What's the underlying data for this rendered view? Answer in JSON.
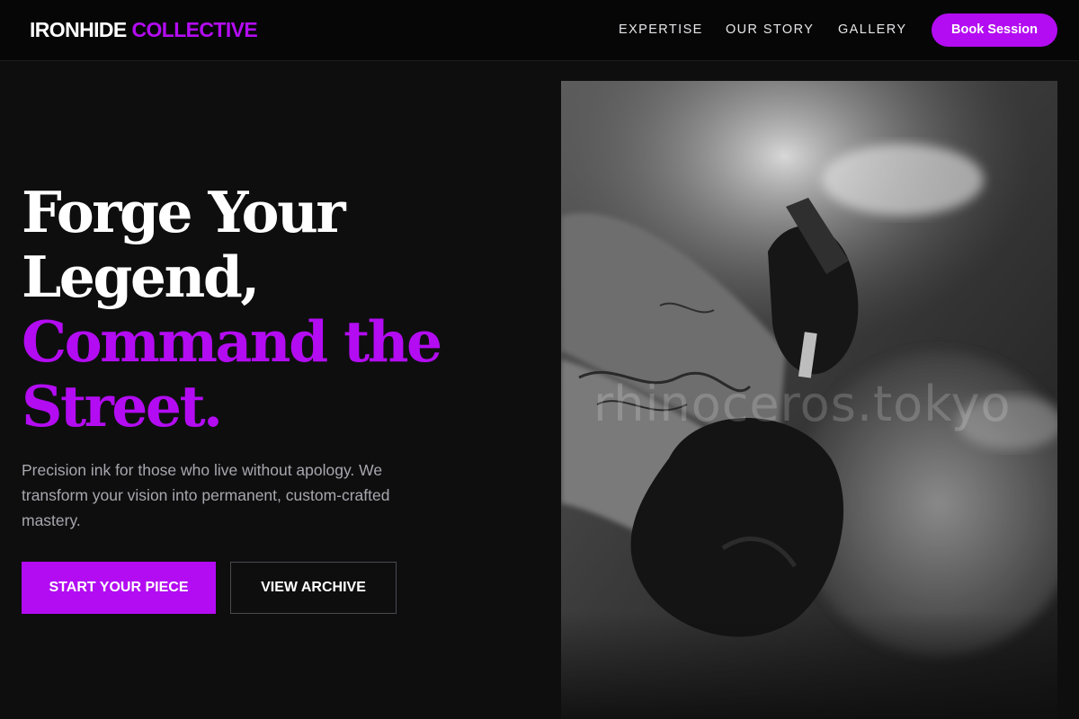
{
  "header": {
    "logo_primary": "IRONHIDE",
    "logo_accent": "COLLECTIVE",
    "nav": [
      {
        "label": "EXPERTISE"
      },
      {
        "label": "OUR STORY"
      },
      {
        "label": "GALLERY"
      }
    ],
    "cta_label": "Book Session"
  },
  "hero": {
    "headline_lines": [
      "Forge Your",
      "Legend,",
      "Command the",
      "Street."
    ],
    "description": "Precision ink for those who live without apology. We transform your vision into permanent, custom-crafted mastery.",
    "primary_button": "START YOUR PIECE",
    "secondary_button": "VIEW ARCHIVE"
  },
  "image": {
    "watermark": "rhinoceros.tokyo"
  },
  "colors": {
    "accent": "#b30cf2",
    "background": "#0e0e0f",
    "header_background": "#060607",
    "body_text": "#a7a7ae"
  }
}
